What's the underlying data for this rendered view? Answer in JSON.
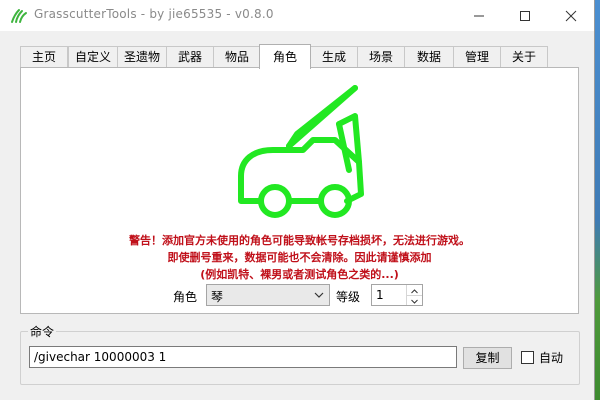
{
  "window": {
    "title": "GrasscutterTools  - by jie65535  - v0.8.0"
  },
  "tabs": [
    {
      "label": "主页"
    },
    {
      "label": "自定义"
    },
    {
      "label": "圣遗物"
    },
    {
      "label": "武器"
    },
    {
      "label": "物品"
    },
    {
      "label": "角色",
      "active": true
    },
    {
      "label": "生成"
    },
    {
      "label": "场景"
    },
    {
      "label": "数据"
    },
    {
      "label": "管理"
    },
    {
      "label": "关于"
    }
  ],
  "character_panel": {
    "icon": "car-trunk-open-icon",
    "icon_color": "#22e822",
    "warning_color": "#c0101a",
    "warning_lines": [
      "警告！添加官方未使用的角色可能导致帐号存档损坏，无法进行游戏。",
      "即使删号重来，数据可能也不会清除。因此请谨慎添加",
      "(例如凯特、裸男或者测试角色之类的...)"
    ],
    "character_label": "角色",
    "character_selected": "琴",
    "level_label": "等级",
    "level_value": "1"
  },
  "command": {
    "group_label": "命令",
    "value": "/givechar 10000003 1",
    "copy_label": "复制",
    "auto_label": "自动",
    "auto_checked": false
  }
}
